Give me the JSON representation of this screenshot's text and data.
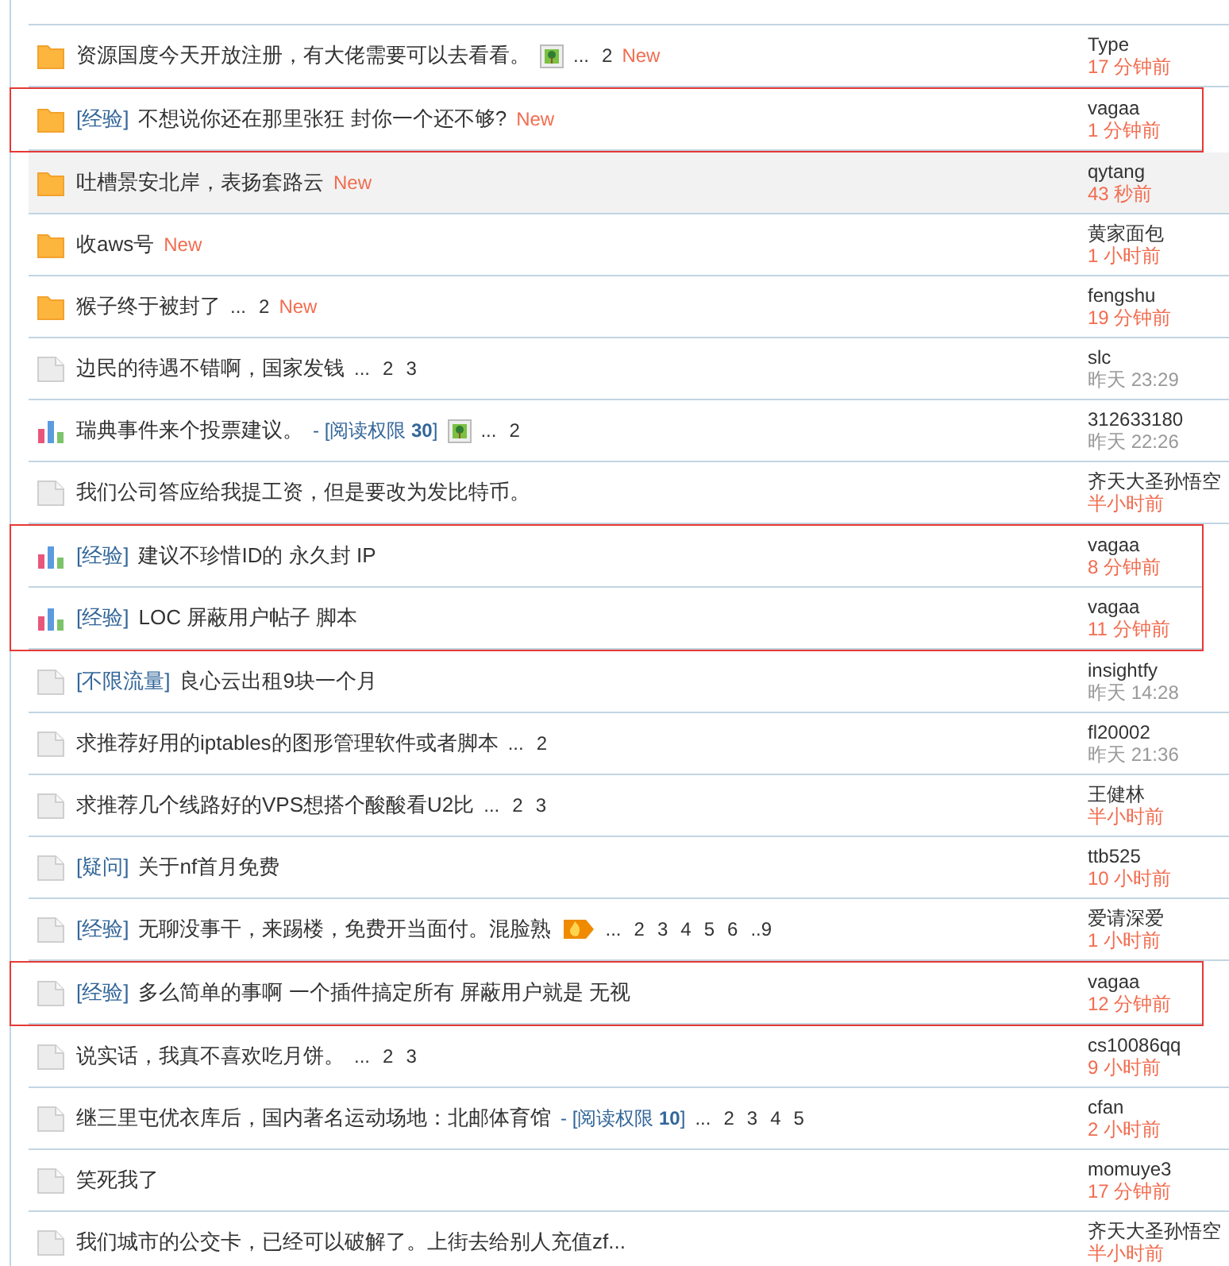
{
  "threads": [
    {
      "kind": "folder_new",
      "title": "资源国度今天开放注册，有大佬需要可以去看看。",
      "has_image": true,
      "hot": false,
      "pages": [
        "...",
        "2"
      ],
      "new": "New",
      "author": "Type",
      "time": "17 分钟前",
      "recent": true,
      "selected": false,
      "highlighted": false
    },
    {
      "kind": "folder_new",
      "category": "[经验]",
      "title": "不想说你还在那里张狂 封你一个还不够?",
      "has_image": false,
      "hot": false,
      "new": "New",
      "author": "vagaa",
      "time": "1 分钟前",
      "recent": true,
      "selected": false,
      "highlighted": true
    },
    {
      "kind": "folder_new",
      "title": "吐槽景安北岸，表扬套路云",
      "has_image": false,
      "hot": false,
      "new": "New",
      "author": "qytang",
      "time": "43 秒前",
      "recent": true,
      "selected": true,
      "highlighted": false
    },
    {
      "kind": "folder_new",
      "title": "收aws号",
      "has_image": false,
      "hot": false,
      "new": "New",
      "author": "黄家面包",
      "time": "1 小时前",
      "recent": true,
      "selected": false,
      "highlighted": false
    },
    {
      "kind": "folder_new",
      "title": "猴子终于被封了",
      "has_image": false,
      "hot": false,
      "pages": [
        "...",
        "2"
      ],
      "new": "New",
      "author": "fengshu",
      "time": "19 分钟前",
      "recent": true,
      "selected": false,
      "highlighted": false
    },
    {
      "kind": "folder",
      "title": "边民的待遇不错啊，国家发钱",
      "has_image": false,
      "hot": false,
      "pages": [
        "...",
        "2",
        "3"
      ],
      "author": "slc",
      "time": "昨天 23:29",
      "recent": false,
      "selected": false,
      "highlighted": false
    },
    {
      "kind": "poll",
      "title": "瑞典事件来个投票建议。",
      "read_permission": "- [阅读权限 **30**]",
      "has_image": true,
      "hot": false,
      "pages": [
        "...",
        "2"
      ],
      "author": "312633180",
      "time": "昨天 22:26",
      "recent": false,
      "selected": false,
      "highlighted": false
    },
    {
      "kind": "folder",
      "title": "我们公司答应给我提工资，但是要改为发比特币。",
      "has_image": false,
      "hot": false,
      "author": "齐天大圣孙悟空",
      "time": "半小时前",
      "recent": true,
      "selected": false,
      "highlighted": false
    },
    {
      "kind": "poll",
      "category": "[经验]",
      "title": "建议不珍惜ID的 永久封 IP",
      "has_image": false,
      "hot": false,
      "author": "vagaa",
      "time": "8 分钟前",
      "recent": true,
      "selected": false,
      "highlighted": true
    },
    {
      "kind": "poll",
      "category": "[经验]",
      "title": "LOC 屏蔽用户帖子 脚本",
      "has_image": false,
      "hot": false,
      "author": "vagaa",
      "time": "11 分钟前",
      "recent": true,
      "selected": false,
      "highlighted": true
    },
    {
      "kind": "folder",
      "category": "[不限流量]",
      "title": "良心云出租9块一个月",
      "has_image": false,
      "hot": false,
      "author": "insightfy",
      "time": "昨天 14:28",
      "recent": false,
      "selected": false,
      "highlighted": false
    },
    {
      "kind": "folder",
      "title": "求推荐好用的iptables的图形管理软件或者脚本",
      "has_image": false,
      "hot": false,
      "pages": [
        "...",
        "2"
      ],
      "author": "fl20002",
      "time": "昨天 21:36",
      "recent": false,
      "selected": false,
      "highlighted": false
    },
    {
      "kind": "folder",
      "title": "求推荐几个线路好的VPS想搭个酸酸看U2比",
      "has_image": false,
      "hot": false,
      "pages": [
        "...",
        "2",
        "3"
      ],
      "author": "王健林",
      "time": "半小时前",
      "recent": true,
      "selected": false,
      "highlighted": false
    },
    {
      "kind": "folder",
      "category": "[疑问]",
      "title": "关于nf首月免费",
      "has_image": false,
      "hot": false,
      "author": "ttb525",
      "time": "10 小时前",
      "recent": true,
      "selected": false,
      "highlighted": false
    },
    {
      "kind": "folder",
      "category": "[经验]",
      "title": "无聊没事干，来踢楼，免费开当面付。混脸熟",
      "has_image": false,
      "hot": true,
      "pages": [
        "...",
        "2",
        "3",
        "4",
        "5",
        "6",
        "..9"
      ],
      "author": "爱请深爱",
      "time": "1 小时前",
      "recent": true,
      "selected": false,
      "highlighted": false
    },
    {
      "kind": "folder",
      "category": "[经验]",
      "title": "多么简单的事啊 一个插件搞定所有 屏蔽用户就是 无视",
      "has_image": false,
      "hot": false,
      "author": "vagaa",
      "time": "12 分钟前",
      "recent": true,
      "selected": false,
      "highlighted": true
    },
    {
      "kind": "folder",
      "title": "说实话，我真不喜欢吃月饼。",
      "has_image": false,
      "hot": false,
      "pages": [
        "...",
        "2",
        "3"
      ],
      "author": "cs10086qq",
      "time": "9 小时前",
      "recent": true,
      "selected": false,
      "highlighted": false
    },
    {
      "kind": "folder",
      "title": "继三里屯优衣库后，国内著名运动场地：北邮体育馆",
      "read_permission": "- [阅读权限 **10**]",
      "has_image": false,
      "hot": false,
      "pages": [
        "...",
        "2",
        "3",
        "4",
        "5"
      ],
      "author": "cfan",
      "time": "2 小时前",
      "recent": true,
      "selected": false,
      "highlighted": false
    },
    {
      "kind": "folder",
      "title": "笑死我了",
      "has_image": false,
      "hot": false,
      "author": "momuye3",
      "time": "17 分钟前",
      "recent": true,
      "selected": false,
      "highlighted": false
    },
    {
      "kind": "folder",
      "title": "我们城市的公交卡，已经可以破解了。上街去给别人充值zf...",
      "has_image": false,
      "hot": false,
      "author": "齐天大圣孙悟空",
      "time": "半小时前",
      "recent": true,
      "selected": false,
      "highlighted": false
    }
  ]
}
